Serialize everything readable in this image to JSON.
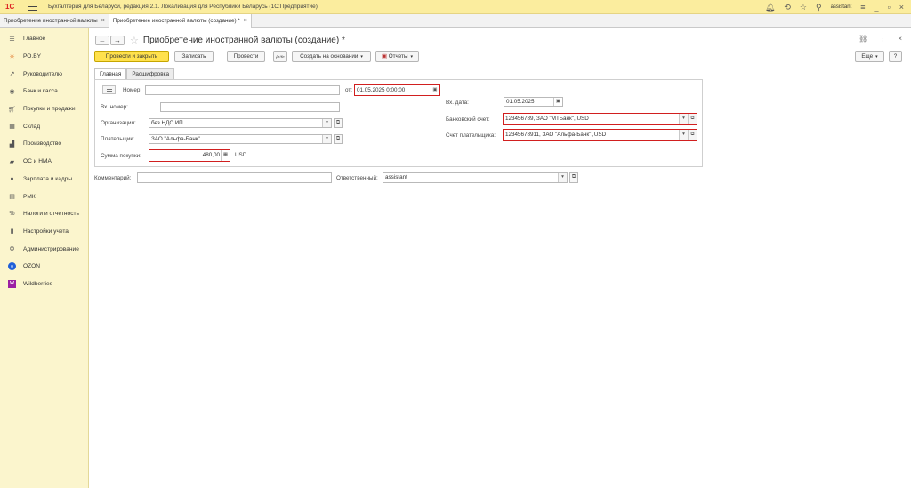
{
  "app": {
    "logo": "1C",
    "title": "Бухгалтерия для Беларуси, редакция 2.1. Локализация для Республики Беларусь   (1С:Предприятие)",
    "user": "assistant"
  },
  "doc_tabs": [
    {
      "label": "Приобретение иностранной валюты",
      "close": "×"
    },
    {
      "label": "Приобретение иностранной валюты (создание) *",
      "close": "×"
    }
  ],
  "sidebar": {
    "items": [
      {
        "label": "Главное",
        "icon": "menu-icon"
      },
      {
        "label": "РО.BY",
        "icon": "sun-icon"
      },
      {
        "label": "Руководителю",
        "icon": "trend-icon"
      },
      {
        "label": "Банк и касса",
        "icon": "bank-icon"
      },
      {
        "label": "Покупки и продажи",
        "icon": "cart-icon"
      },
      {
        "label": "Склад",
        "icon": "warehouse-icon"
      },
      {
        "label": "Производство",
        "icon": "factory-icon"
      },
      {
        "label": "ОС и НМА",
        "icon": "truck-icon"
      },
      {
        "label": "Зарплата и кадры",
        "icon": "person-icon"
      },
      {
        "label": "РМК",
        "icon": "register-icon"
      },
      {
        "label": "Налоги и отчетность",
        "icon": "percent-icon"
      },
      {
        "label": "Настройки учета",
        "icon": "book-icon"
      },
      {
        "label": "Администрирование",
        "icon": "gear-icon"
      },
      {
        "label": "OZON",
        "icon": "ozon-icon"
      },
      {
        "label": "Wildberries",
        "icon": "wildberries-icon"
      }
    ]
  },
  "header": {
    "back": "←",
    "forward": "→",
    "star": "☆",
    "title": "Приобретение иностранной валюты (создание) *",
    "link": "🔗",
    "more": "⋮",
    "close": "×"
  },
  "toolbar": {
    "post_close": "Провести и закрыть",
    "save": "Записать",
    "post": "Провести",
    "dtkt": "Дт/Кт",
    "create_based": "Создать на основании",
    "reports": "Отчеты",
    "more": "Еще",
    "help": "?"
  },
  "inner_tabs": [
    "Главная",
    "Расшифровка"
  ],
  "form": {
    "number_label": "Номер:",
    "number_value": "",
    "date_from_label": "от:",
    "date_value": "01.05.2025  0:00:00",
    "in_number_label": "Вх. номер:",
    "in_number_value": "",
    "in_date_label": "Вх. дата:",
    "in_date_value": "01.05.2025",
    "org_label": "Организация:",
    "org_value": "без НДС ИП",
    "bank_account_label": "Банковский счет:",
    "bank_account_value": "123456789, ЗАО \"МТБанк\", USD",
    "payer_label": "Плательщик:",
    "payer_value": "ЗАО \"Альфа-Банк\"",
    "payer_account_label": "Счет плательщика:",
    "payer_account_value": "12345678911, ЗАО \"Альфа-Банк\", USD",
    "amount_label": "Сумма покупки:",
    "amount_value": "480,00",
    "currency": "USD",
    "comment_label": "Комментарий:",
    "comment_value": "",
    "responsible_label": "Ответственный:",
    "responsible_value": "assistant"
  },
  "colors": {
    "accent": "#ffe14d",
    "sidebar": "#fbf5cd",
    "titlebar": "#fbed9e",
    "highlight": "#d11f1f"
  }
}
